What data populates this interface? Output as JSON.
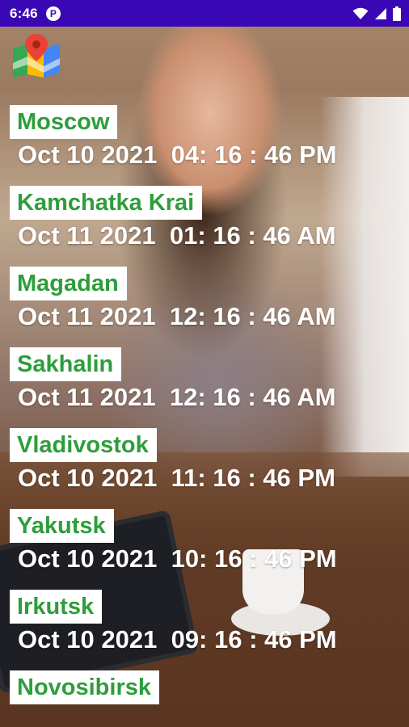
{
  "status_bar": {
    "time": "6:46",
    "app_icon_glyph": "P",
    "icons": [
      "wifi-icon",
      "signal-icon",
      "battery-icon"
    ]
  },
  "app": {
    "logo_icon": "map-pin-icon"
  },
  "cities": [
    {
      "name": "Moscow",
      "datetime": "Oct 10 2021  04: 16 : 46 PM"
    },
    {
      "name": "Kamchatka Krai",
      "datetime": "Oct 11 2021  01: 16 : 46 AM"
    },
    {
      "name": "Magadan",
      "datetime": "Oct 11 2021  12: 16 : 46 AM"
    },
    {
      "name": "Sakhalin",
      "datetime": "Oct 11 2021  12: 16 : 46 AM"
    },
    {
      "name": "Vladivostok",
      "datetime": "Oct 10 2021  11: 16 : 46 PM"
    },
    {
      "name": "Yakutsk",
      "datetime": "Oct 10 2021  10: 16 : 46 PM"
    },
    {
      "name": "Irkutsk",
      "datetime": "Oct 10 2021  09: 16 : 46 PM"
    },
    {
      "name": "Novosibirsk",
      "datetime": ""
    }
  ],
  "colors": {
    "status_bar": "#3a07b5",
    "city_label_text": "#2e9d3b",
    "city_label_bg": "#ffffff",
    "time_text": "#ffffff"
  }
}
